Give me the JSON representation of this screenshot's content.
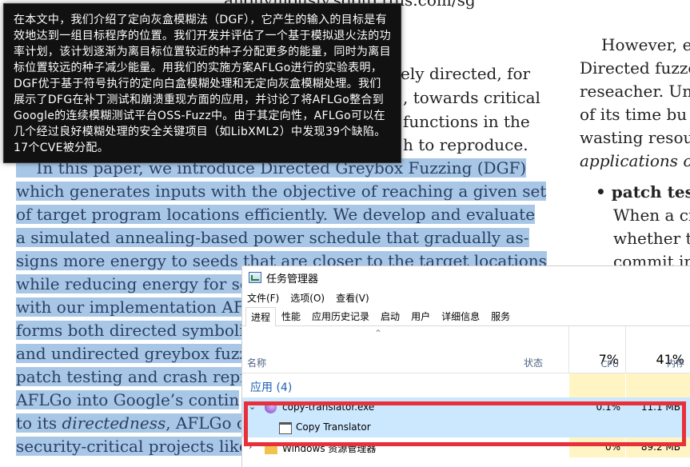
{
  "pdf": {
    "top_partial": "anonymously.sdolp.rdis.com/sg",
    "left_lines_plain": [
      {
        "text": "ely directed, for"
      },
      {
        "text": ", towards critical"
      },
      {
        "text": "functions in the"
      },
      {
        "text": "h to reproduce."
      }
    ],
    "left_lines_highlighted": [
      "    In this paper, we introduce Directed Greybox Fuzzing (DGF)",
      "which generates inputs with the objective of reaching a given set",
      "of target program locations efficiently. We develop and evaluate",
      "a simulated annealing-based power schedule that gradually as-",
      "signs more energy to seeds that are closer to the target locations",
      "while reducing energy for see",
      "with our implementation AF",
      "forms both directed symboli",
      "and undirected greybox fuzz",
      "patch testing and crash repro",
      "AFLGo into Google’s contin",
      "to its directedness, AFLGo cou",
      "security-critical projects like"
    ],
    "right_lines": [
      {
        "text": "However, ex",
        "style": "normal"
      },
      {
        "text": "Directed fuzze",
        "style": "normal"
      },
      {
        "text": "reseacher. Unl",
        "style": "normal"
      },
      {
        "text": "of its time bu",
        "style": "normal"
      },
      {
        "text": "wasting resour",
        "style": "normal"
      },
      {
        "text": "applications of",
        "style": "italic"
      },
      {
        "text": "• patch tes",
        "style": "bold"
      },
      {
        "text": "When a cr",
        "style": "normal"
      },
      {
        "text": "whether th",
        "style": "normal"
      },
      {
        "text": "commit in",
        "style": "normal"
      }
    ]
  },
  "translator": {
    "text": "在本文中，我们介绍了定向灰盒模糊法（DGF），它产生的输入的目标是有效地达到一组目标程序的位置。我们开发并评估了一个基于模拟退火法的功率计划，该计划逐渐为离目标位置较近的种子分配更多的能量，同时为离目标位置较远的种子减少能量。用我们的实施方案AFLGo进行的实验表明，DGF优于基于符号执行的定向白盒模糊处理和无定向灰盒模糊处理。我们展示了DFG在补丁测试和崩溃重现方面的应用，并讨论了将AFLGo整合到Google的连续模糊测试平台OSS-Fuzz中。由于其定向性，AFLGo可以在几个经过良好模糊处理的安全关键项目（如LibXML2）中发现39个缺陷。17个CVE被分配。"
  },
  "task_manager": {
    "title": "任务管理器",
    "menu": [
      "文件(F)",
      "选项(O)",
      "查看(V)"
    ],
    "tabs": [
      "进程",
      "性能",
      "应用历史记录",
      "启动",
      "用户",
      "详细信息",
      "服务"
    ],
    "active_tab": "进程",
    "columns": {
      "name": "名称",
      "status": "状态",
      "cpu_label": "CPU",
      "mem_label": "内存"
    },
    "cpu_total": "7%",
    "mem_total": "41%",
    "group_label": "应用 (4)",
    "highlight_color": "#e8303a",
    "processes": [
      {
        "name": "copy-translator.exe",
        "cpu": "0.1%",
        "mem": "11.1 MB",
        "child": "Copy Translator"
      },
      {
        "name": "Windows 资源管理器",
        "cpu": "0%",
        "mem": "89.2 MB"
      }
    ]
  }
}
